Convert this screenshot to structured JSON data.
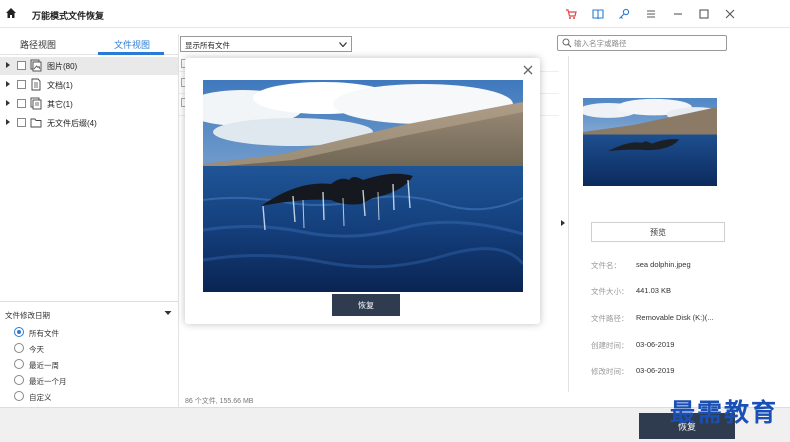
{
  "app": {
    "title": "万能模式文件恢复"
  },
  "tabs": [
    {
      "label": "路径视图"
    },
    {
      "label": "文件视图"
    }
  ],
  "tree": [
    {
      "label": "图片(80)"
    },
    {
      "label": "文档(1)"
    },
    {
      "label": "其它(1)"
    },
    {
      "label": "无文件后缀(4)"
    }
  ],
  "filter": {
    "selected": "显示所有文件"
  },
  "search": {
    "placeholder": "输入名字或路径"
  },
  "date_filter": {
    "title": "文件修改日期",
    "options": [
      "所有文件",
      "今天",
      "最近一周",
      "最近一个月",
      "自定义"
    ],
    "selected_index": 0
  },
  "status": {
    "summary": "86 个文件, 155.66  MB"
  },
  "file_info": {
    "preview_label": "预览",
    "rows": [
      {
        "key": "文件名：",
        "value": "sea dolphin.jpeg"
      },
      {
        "key": "文件大小：",
        "value": "441.03   KB"
      },
      {
        "key": "文件路径：",
        "value": "Removable Disk (K:)(..."
      },
      {
        "key": "创建时间：",
        "value": "03-06-2019"
      },
      {
        "key": "修改时间：",
        "value": "03-06-2019"
      }
    ]
  },
  "modal": {
    "recover_label": "恢复"
  },
  "bottom": {
    "recover_label": "恢复"
  },
  "watermark": "最需教育",
  "colors": {
    "accent": "#2a7bd6",
    "button_dark": "#2f3c4f",
    "cart_red": "#e04545"
  }
}
